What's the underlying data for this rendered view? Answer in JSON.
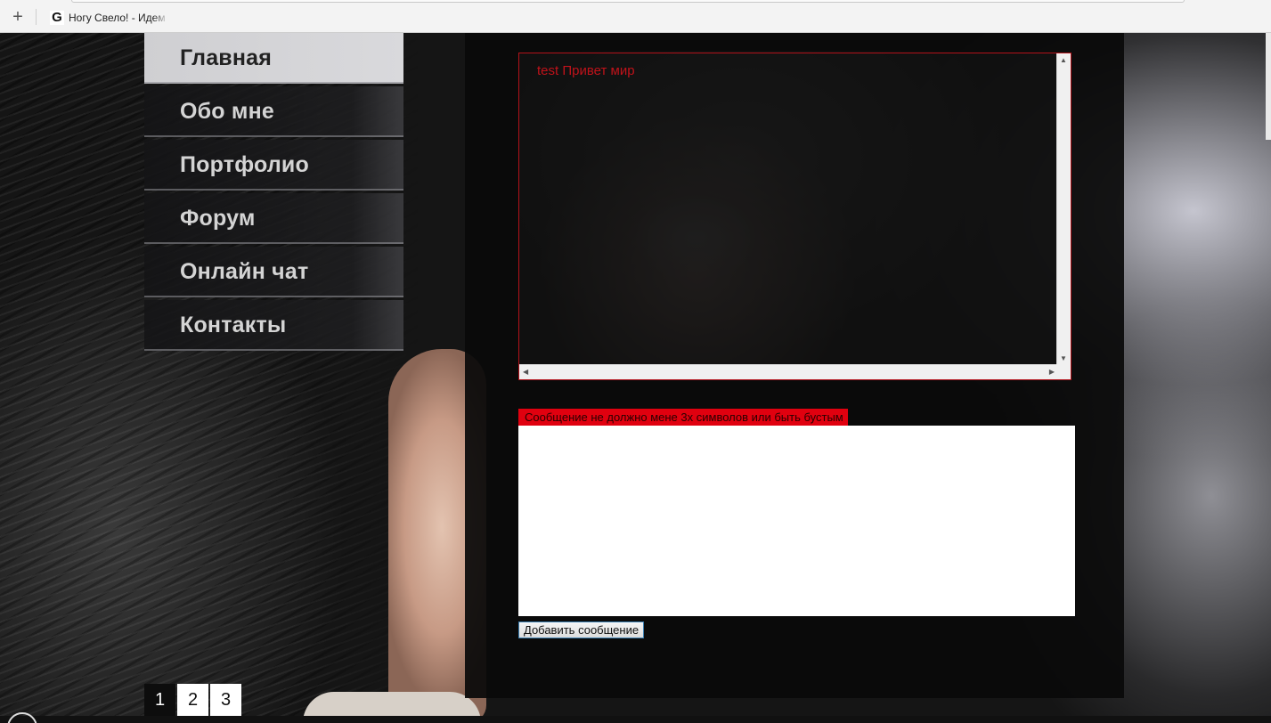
{
  "browser": {
    "new_tab_icon": "+",
    "bookmark_favicon": "G",
    "bookmark_title": "Ногу Свело! - Идем"
  },
  "nav": {
    "items": [
      {
        "label": "Главная",
        "active": true
      },
      {
        "label": "Обо мне",
        "active": false
      },
      {
        "label": "Портфолио",
        "active": false
      },
      {
        "label": "Форум",
        "active": false
      },
      {
        "label": "Онлайн чат",
        "active": false
      },
      {
        "label": "Контакты",
        "active": false
      }
    ]
  },
  "chat": {
    "messages": [
      {
        "text": "test Привет мир"
      }
    ],
    "scroll_up_icon": "▲",
    "scroll_down_icon": "▼",
    "scroll_left_icon": "◀",
    "scroll_right_icon": "▶"
  },
  "form": {
    "error_text": "Сообщение не должно мене 3х символов или быть бустым",
    "message_value": "",
    "submit_label": "Добавить сообщение"
  },
  "pagination": {
    "pages": [
      "1",
      "2",
      "3"
    ],
    "current": "1"
  },
  "colors": {
    "accent_red": "#e0000f",
    "chat_text": "#c0121a",
    "panel": "#0a0a0a"
  }
}
